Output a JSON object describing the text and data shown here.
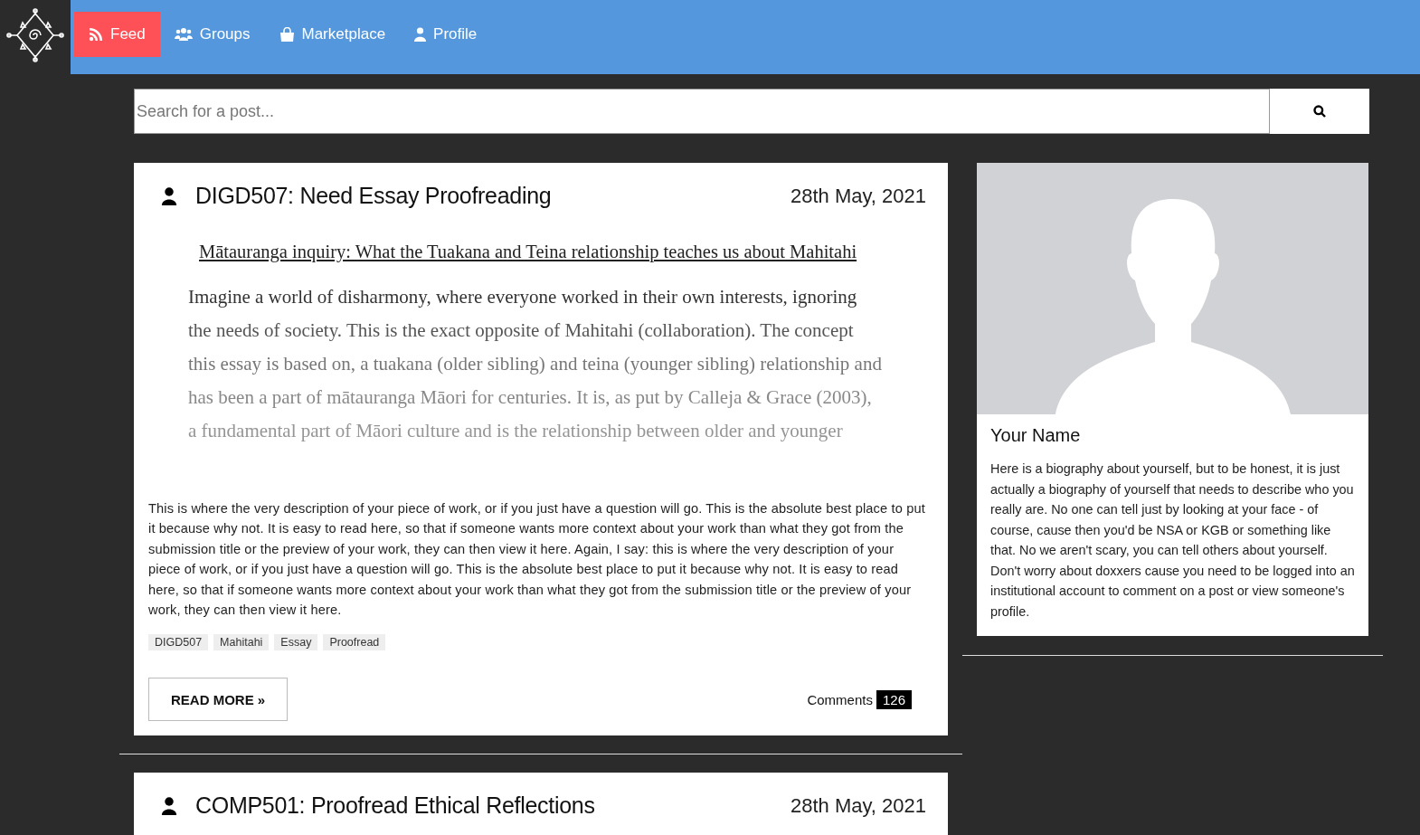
{
  "nav": {
    "items": [
      {
        "label": "Feed",
        "kind": "rss",
        "selected": true
      },
      {
        "label": "Groups",
        "kind": "users",
        "selected": false
      },
      {
        "label": "Marketplace",
        "kind": "bag",
        "selected": false
      },
      {
        "label": "Profile",
        "kind": "user",
        "selected": false
      }
    ]
  },
  "search": {
    "placeholder": "Search for a post..."
  },
  "posts": [
    {
      "title": "DIGD507: Need Essay Proofreading",
      "date": "28th May, 2021",
      "preview": {
        "heading": "Mātauranga inquiry: What the Tuakana and Teina relationship teaches us about Mahitahi",
        "lines": [
          "Imagine a world of disharmony, where everyone worked in their own interests, ignoring",
          "the needs of society. This is the exact opposite of Mahitahi (collaboration). The concept",
          "this essay is based on, a tuakana (older sibling) and teina (younger sibling) relationship and",
          "has been a part of mātauranga Māori for centuries. It is, as put by Calleja & Grace (2003),",
          "a fundamental part of Māori culture and is the relationship between older and younger"
        ]
      },
      "description": "This is where the very description of your piece of work, or if you just have a question will go. This is the absolute best place to put it because why not. It is easy to read here, so that if someone wants more context about your work than what they got from the submission title or the preview of your work, they can then view it here. Again, I say: this is where the very description of your piece of work, or if you just have a question will go. This is the absolute best place to put it because why not. It is easy to read here, so that if someone wants more context about your work than what they got from the submission title or the preview of your work, they can then view it here.",
      "tags": [
        "DIGD507",
        "Mahitahi",
        "Essay",
        "Proofread"
      ],
      "read_more": "READ MORE »",
      "comments_label": "Comments",
      "comments_count": "126"
    },
    {
      "title": "COMP501: Proofread Ethical Reflections",
      "date": "28th May, 2021"
    }
  ],
  "profile": {
    "name": "Your Name",
    "bio": "Here is a biography about yourself, but to be honest, it is just actually a biography of yourself that needs to describe who you really are. No one can tell just by looking at your face - of course, cause then you'd be NSA or KGB or something like that. No we aren't scary, you can tell others about yourself. Don't worry about doxxers cause you need to be logged into an institutional account to comment on a post or view someone's profile."
  }
}
